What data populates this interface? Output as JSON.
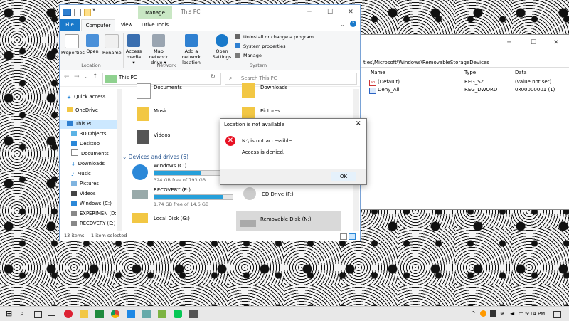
{
  "registry": {
    "path": "ties\\Microsoft\\Windows\\RemovableStorageDevices",
    "columns": [
      "Name",
      "Type",
      "Data"
    ],
    "rows": [
      {
        "name": "(Default)",
        "type": "REG_SZ",
        "data": "(value not set)",
        "icon": "ab-string-icon"
      },
      {
        "name": "Deny_All",
        "type": "REG_DWORD",
        "data": "0x00000001 (1)",
        "icon": "binary-value-icon"
      }
    ]
  },
  "explorer": {
    "title": "This PC",
    "context_tab": "Manage",
    "tabs": [
      "File",
      "Computer",
      "View",
      "Drive Tools"
    ],
    "ribbon": {
      "location": {
        "label": "Location",
        "buttons": [
          "Properties",
          "Open",
          "Rename"
        ]
      },
      "network": {
        "label": "Network",
        "buttons": [
          "Access media",
          "Map network drive",
          "Add a network location"
        ]
      },
      "system": {
        "label": "System",
        "buttons": [
          "Open Settings"
        ],
        "small": [
          "Uninstall or change a program",
          "System properties",
          "Manage"
        ]
      }
    },
    "address": "This PC",
    "search_placeholder": "Search This PC",
    "nav": [
      "Quick access",
      "OneDrive",
      "This PC",
      "3D Objects",
      "Desktop",
      "Documents",
      "Downloads",
      "Music",
      "Pictures",
      "Videos",
      "Windows (C:)",
      "EXPERIMEN (D:)",
      "RECOVERY (E:)"
    ],
    "folders": [
      "Documents",
      "Downloads",
      "Music",
      "Pictures",
      "Videos"
    ],
    "devices_header": "Devices and drives (6)",
    "drives": [
      {
        "name": "Windows (C:)",
        "free": "324 GB free of 793 GB",
        "fill": 0.59
      },
      {
        "name": "RECOVERY (E:)",
        "free": "1.74 GB free of 14.6 GB",
        "fill": 0.88
      },
      {
        "name": "CD Drive (F:)"
      },
      {
        "name": "Local Disk (G:)"
      },
      {
        "name": "Removable Disk (N:)"
      }
    ],
    "status": {
      "items": "13 items",
      "selected": "1 item selected"
    }
  },
  "dialog": {
    "title": "Location is not available",
    "message": "N:\\ is not accessible.",
    "detail": "Access is denied.",
    "ok": "OK"
  },
  "taskbar": {
    "time": "5:14 PM"
  },
  "colors": {
    "accent": "#0078d7",
    "manage_tab": "#c9e7c4",
    "selected_nav": "#cce8ff",
    "error": "#e81123",
    "bar": "#26a0da"
  }
}
